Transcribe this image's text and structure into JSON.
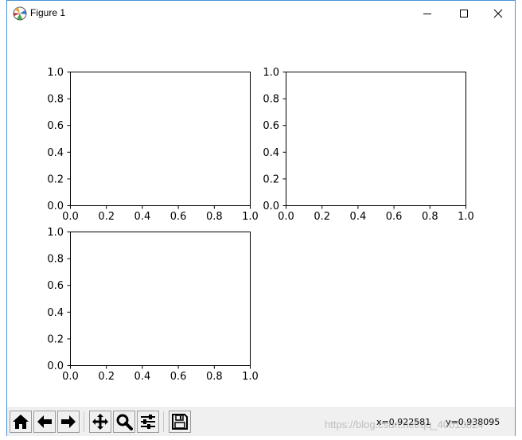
{
  "window": {
    "title": "Figure 1",
    "controls": [
      "minimize",
      "maximize",
      "close"
    ]
  },
  "figure": {
    "axes": [
      {
        "id": "ax1",
        "xticks": [
          "0.0",
          "0.2",
          "0.4",
          "0.6",
          "0.8",
          "1.0"
        ],
        "yticks": [
          "0.0",
          "0.2",
          "0.4",
          "0.6",
          "0.8",
          "1.0"
        ]
      },
      {
        "id": "ax2",
        "xticks": [
          "0.0",
          "0.2",
          "0.4",
          "0.6",
          "0.8",
          "1.0"
        ],
        "yticks": [
          "0.0",
          "0.2",
          "0.4",
          "0.6",
          "0.8",
          "1.0"
        ]
      },
      {
        "id": "ax3",
        "xticks": [
          "0.0",
          "0.2",
          "0.4",
          "0.6",
          "0.8",
          "1.0"
        ],
        "yticks": [
          "0.0",
          "0.2",
          "0.4",
          "0.6",
          "0.8",
          "1.0"
        ]
      }
    ]
  },
  "toolbar": {
    "buttons": [
      {
        "name": "home-button",
        "icon": "home-icon"
      },
      {
        "name": "back-button",
        "icon": "arrow-left-icon"
      },
      {
        "name": "forward-button",
        "icon": "arrow-right-icon"
      },
      {
        "name": "pan-button",
        "icon": "move-icon"
      },
      {
        "name": "zoom-button",
        "icon": "magnifier-icon"
      },
      {
        "name": "configure-subplots-button",
        "icon": "sliders-icon"
      },
      {
        "name": "save-button",
        "icon": "floppy-disk-icon"
      }
    ],
    "x_readout": "x=0.922581",
    "y_readout": "y=0.938095"
  },
  "watermark": "https://blog.csdn.net/qq_40010824",
  "colors": {
    "window_border": "#4a90d9",
    "toolbar_bg": "#f0f0f0",
    "axes_edge": "#000000"
  },
  "chart_data": [
    {
      "type": "line",
      "title": "",
      "xlabel": "",
      "ylabel": "",
      "xlim": [
        0,
        1
      ],
      "ylim": [
        0,
        1
      ],
      "series": []
    },
    {
      "type": "line",
      "title": "",
      "xlabel": "",
      "ylabel": "",
      "xlim": [
        0,
        1
      ],
      "ylim": [
        0,
        1
      ],
      "series": []
    },
    {
      "type": "line",
      "title": "",
      "xlabel": "",
      "ylabel": "",
      "xlim": [
        0,
        1
      ],
      "ylim": [
        0,
        1
      ],
      "series": []
    }
  ]
}
